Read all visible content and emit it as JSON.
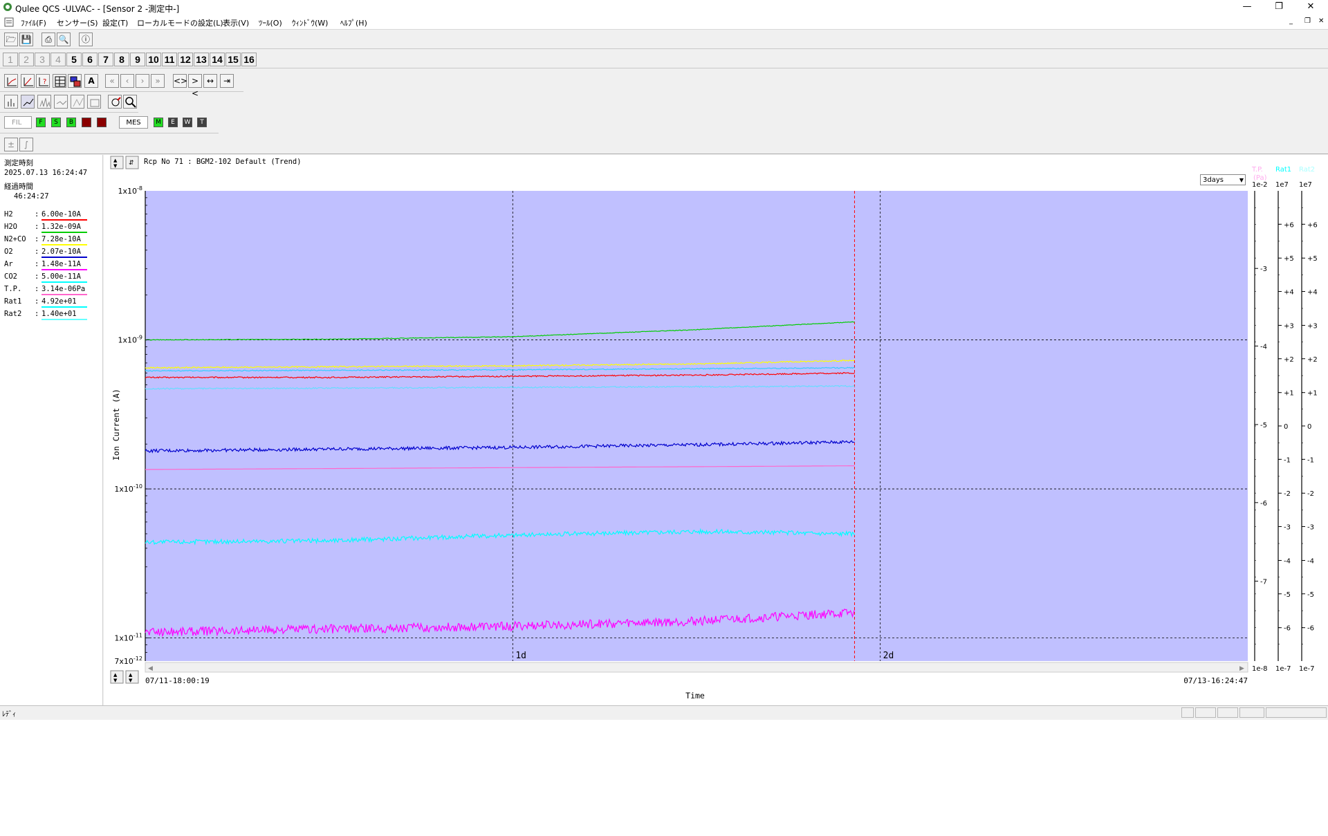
{
  "window": {
    "title": "Qulee QCS -ULVAC-  - [Sensor 2 -測定中-]"
  },
  "menu": [
    "ﾌｧｲﾙ(F)",
    "センサー(S)",
    "設定(T)",
    "ローカルモードの設定(L)",
    "表示(V)",
    "ﾂｰﾙ(O)",
    "ｳｨﾝﾄﾞｳ(W)",
    "ﾍﾙﾌﾟ(H)"
  ],
  "channels": {
    "disabled": [
      "1",
      "2",
      "3",
      "4"
    ],
    "enabled": [
      "5",
      "6",
      "7",
      "8",
      "9",
      "10",
      "11",
      "12",
      "13",
      "14",
      "15",
      "16"
    ]
  },
  "toolbar": {
    "fil_label": "FIL",
    "mes_label": "MES",
    "filament_buttons": [
      {
        "label": "F",
        "color": "#22dd22"
      },
      {
        "label": "S",
        "color": "#22dd22"
      },
      {
        "label": "B",
        "color": "#22dd22"
      },
      {
        "label": "",
        "color": "#8b0000"
      },
      {
        "label": "",
        "color": "#8b0000"
      }
    ],
    "mes_buttons": [
      {
        "label": "M",
        "color": "#22dd22"
      },
      {
        "label": "E",
        "color": "#404040"
      },
      {
        "label": "W",
        "color": "#404040"
      },
      {
        "label": "T",
        "color": "#404040"
      }
    ],
    "text_a": "A"
  },
  "left_panel": {
    "measure_time_label": "測定時刻",
    "measure_time": "2025.07.13 16:24:47",
    "elapsed_label": "経過時間",
    "elapsed": "46:24:27",
    "gases": [
      {
        "name": "H2",
        "value": "6.00e-10A",
        "color": "#ff0000"
      },
      {
        "name": "H2O",
        "value": "1.32e-09A",
        "color": "#00cc00"
      },
      {
        "name": "N2+CO",
        "value": "7.28e-10A",
        "color": "#ffff00"
      },
      {
        "name": "O2",
        "value": "2.07e-10A",
        "color": "#0000cc"
      },
      {
        "name": "Ar",
        "value": "1.48e-11A",
        "color": "#ff00ff"
      },
      {
        "name": "CO2",
        "value": "5.00e-11A",
        "color": "#00ffff"
      },
      {
        "name": "T.P.",
        "value": "3.14e-06Pa",
        "color": "#ff66cc"
      },
      {
        "name": "Rat1",
        "value": "4.92e+01",
        "color": "#00ffff"
      },
      {
        "name": "Rat2",
        "value": "1.40e+01",
        "color": "#66ffff"
      }
    ]
  },
  "chart_header": {
    "recipe": "Rcp No 71 : BGM2-102 Default (Trend)"
  },
  "range_select": {
    "value": "3days"
  },
  "chart_data": {
    "type": "line",
    "title": "Rcp No 71 : BGM2-102 Default (Trend)",
    "xlabel": "Time",
    "ylabel": "Ion Current (A)",
    "yscale": "log",
    "ylim": [
      7e-12,
      1e-08
    ],
    "x_start": "07/11-18:00:19",
    "x_end": "07/13-16:24:47",
    "x_range_days": [
      0,
      3
    ],
    "current_time_days": 1.93,
    "x_markers": [
      {
        "label": "1d",
        "value": 1
      },
      {
        "label": "2d",
        "value": 2
      }
    ],
    "y_ticks": [
      {
        "mant": "1x10",
        "exp": "-8",
        "value": 1e-08
      },
      {
        "mant": "1x10",
        "exp": "-9",
        "value": 1e-09
      },
      {
        "mant": "1x10",
        "exp": "-10",
        "value": 1e-10
      },
      {
        "mant": "1x10",
        "exp": "-11",
        "value": 1e-11
      },
      {
        "mant": "7x10",
        "exp": "-12",
        "value": 7e-12
      }
    ],
    "series": [
      {
        "name": "H2",
        "color": "#ff0000",
        "x": [
          0,
          0.5,
          1.0,
          1.5,
          1.93
        ],
        "y": [
          5.6e-10,
          5.6e-10,
          5.7e-10,
          5.8e-10,
          6e-10
        ],
        "noise": 0.01
      },
      {
        "name": "H2O",
        "color": "#00cc00",
        "x": [
          0,
          0.5,
          1.0,
          1.5,
          1.93
        ],
        "y": [
          1e-09,
          1.01e-09,
          1.05e-09,
          1.17e-09,
          1.32e-09
        ],
        "noise": 0.005
      },
      {
        "name": "N2+CO",
        "color": "#ffff00",
        "x": [
          0,
          0.5,
          1.0,
          1.5,
          1.93
        ],
        "y": [
          6.5e-10,
          6.6e-10,
          6.7e-10,
          6.9e-10,
          7.28e-10
        ],
        "noise": 0.01
      },
      {
        "name": "O2",
        "color": "#0000cc",
        "x": [
          0,
          0.5,
          1.0,
          1.5,
          1.93
        ],
        "y": [
          1.8e-10,
          1.85e-10,
          1.9e-10,
          1.98e-10,
          2.07e-10
        ],
        "noise": 0.025
      },
      {
        "name": "Ar",
        "color": "#ff00ff",
        "x": [
          0,
          0.5,
          1.0,
          1.5,
          1.93
        ],
        "y": [
          1.1e-11,
          1.15e-11,
          1.2e-11,
          1.3e-11,
          1.48e-11
        ],
        "noise": 0.07
      },
      {
        "name": "CO2",
        "color": "#00ffff",
        "x": [
          0,
          0.5,
          1.0,
          1.5,
          1.93
        ],
        "y": [
          4.4e-11,
          4.5e-11,
          4.9e-11,
          5.2e-11,
          5e-11
        ],
        "noise": 0.035
      },
      {
        "name": "T.P.",
        "color": "#ff66cc",
        "x": [
          0,
          0.5,
          1.0,
          1.5,
          1.93
        ],
        "y": [
          1.35e-10,
          1.37e-10,
          1.39e-10,
          1.41e-10,
          1.43e-10
        ],
        "noise": 0.0
      },
      {
        "name": "Rat1",
        "color": "#66ddff",
        "x": [
          0,
          0.5,
          1.0,
          1.5,
          1.93
        ],
        "y": [
          4.7e-10,
          4.75e-10,
          4.8e-10,
          4.85e-10,
          4.9e-10
        ],
        "noise": 0.01
      },
      {
        "name": "Rat2",
        "color": "#33ccff",
        "x": [
          0,
          0.5,
          1.0,
          1.5,
          1.93
        ],
        "y": [
          6.2e-10,
          6.25e-10,
          6.3e-10,
          6.4e-10,
          6.5e-10
        ],
        "noise": 0.008
      }
    ],
    "grid": true
  },
  "right_axes": [
    {
      "title": "T.P.",
      "unit": "(Pa)",
      "top": "1e-2",
      "bottom": "1e-8",
      "title_color": "#ffaaee",
      "labels": [
        {
          "text": "-3",
          "frac": 0.165
        },
        {
          "text": "-4",
          "frac": 0.33
        },
        {
          "text": "-5",
          "frac": 0.497
        },
        {
          "text": "-6",
          "frac": 0.663
        },
        {
          "text": "-7",
          "frac": 0.83
        }
      ]
    },
    {
      "title": "Rat1",
      "unit": "",
      "top": "1e7",
      "bottom": "1e-7",
      "title_color": "#00ffff",
      "labels": [
        {
          "text": "+6",
          "frac": 0.071
        },
        {
          "text": "+5",
          "frac": 0.143
        },
        {
          "text": "+4",
          "frac": 0.214
        },
        {
          "text": "+3",
          "frac": 0.286
        },
        {
          "text": "+2",
          "frac": 0.357
        },
        {
          "text": "+1",
          "frac": 0.429
        },
        {
          "text": "0",
          "frac": 0.5
        },
        {
          "text": "-1",
          "frac": 0.571
        },
        {
          "text": "-2",
          "frac": 0.643
        },
        {
          "text": "-3",
          "frac": 0.714
        },
        {
          "text": "-4",
          "frac": 0.786
        },
        {
          "text": "-5",
          "frac": 0.857
        },
        {
          "text": "-6",
          "frac": 0.929
        }
      ]
    },
    {
      "title": "Rat2",
      "unit": "",
      "top": "1e7",
      "bottom": "1e-7",
      "title_color": "#aaffff",
      "labels": [
        {
          "text": "+6",
          "frac": 0.071
        },
        {
          "text": "+5",
          "frac": 0.143
        },
        {
          "text": "+4",
          "frac": 0.214
        },
        {
          "text": "+3",
          "frac": 0.286
        },
        {
          "text": "+2",
          "frac": 0.357
        },
        {
          "text": "+1",
          "frac": 0.429
        },
        {
          "text": "0",
          "frac": 0.5
        },
        {
          "text": "-1",
          "frac": 0.571
        },
        {
          "text": "-2",
          "frac": 0.643
        },
        {
          "text": "-3",
          "frac": 0.714
        },
        {
          "text": "-4",
          "frac": 0.786
        },
        {
          "text": "-5",
          "frac": 0.857
        },
        {
          "text": "-6",
          "frac": 0.929
        }
      ]
    }
  ],
  "status": {
    "text": "ﾚﾃﾞｨ"
  }
}
